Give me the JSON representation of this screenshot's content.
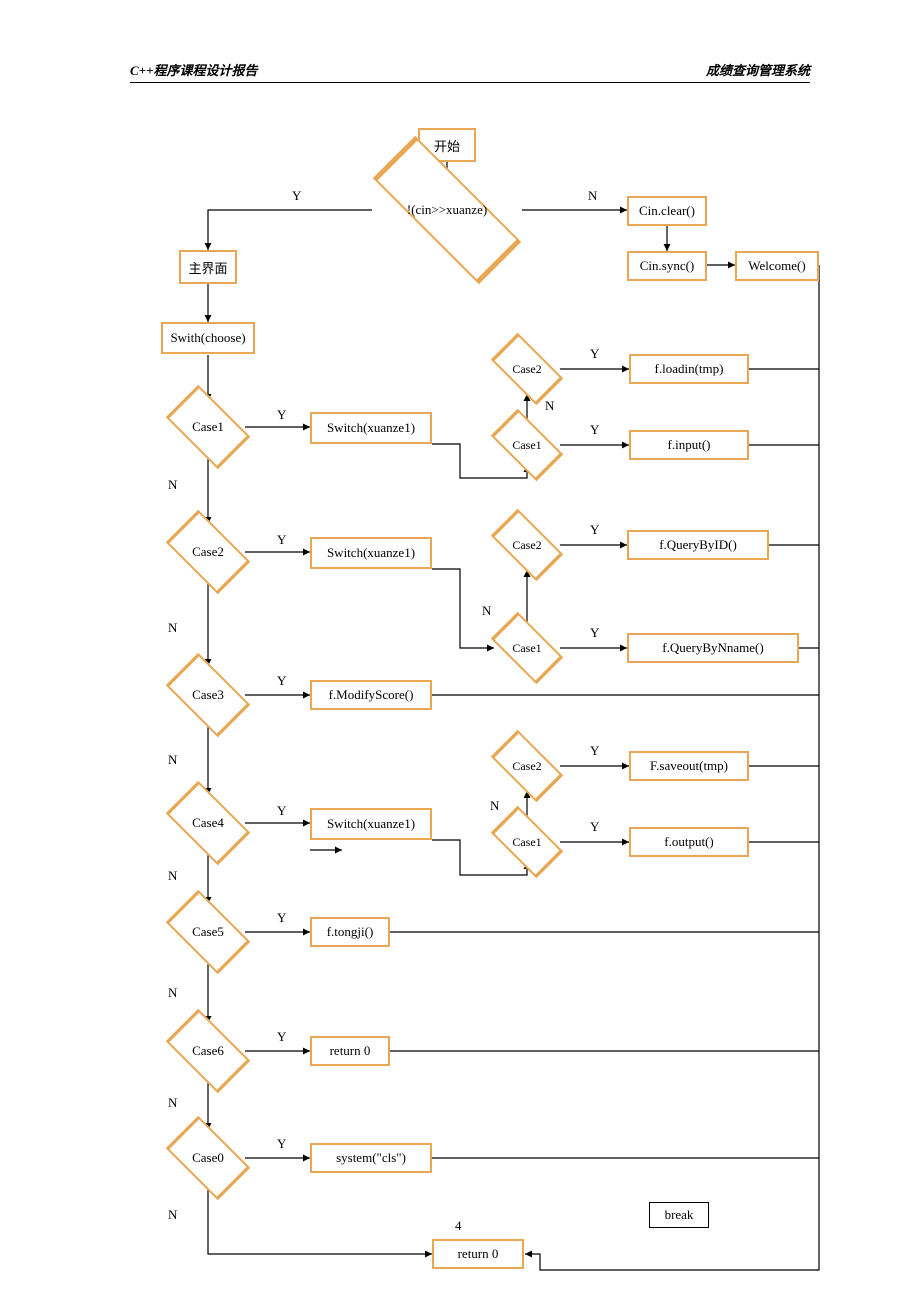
{
  "header": {
    "left": "C++程序课程设计报告",
    "right": "成绩查询管理系统"
  },
  "start": "开始",
  "cin": "!(cin>>xuanze)",
  "cinClear": "Cin.clear()",
  "cinSync": "Cin.sync()",
  "welcome": "Welcome()",
  "main": "主界面",
  "switchChoose": "Swith(choose)",
  "switchX1": "Switch(xuanze1)",
  "switchX2": "Switch(xuanze1)",
  "switchX3": "Switch(xuanze1)",
  "c1": "Case1",
  "c2": "Case2",
  "c3": "Case3",
  "c4": "Case4",
  "c5": "Case5",
  "c6": "Case6",
  "c0": "Case0",
  "sc1": "Case1",
  "sc2": "Case2",
  "scA": "Case1",
  "scB": "Case2",
  "scC": "Case1",
  "scD": "Case2",
  "floadin": "f.loadin(tmp)",
  "finput": "f.input()",
  "qById": "f.QueryByID()",
  "qByName": "f.QueryByNname()",
  "modify": "f.ModifyScore()",
  "saveout": "F.saveout(tmp)",
  "foutput": "f.output()",
  "tongji": "f.tongji()",
  "ret0": "return 0",
  "sysCls": "system(\"cls\")",
  "retEnd": "return 0",
  "break": "break",
  "Y": "Y",
  "N": "N",
  "pageNum": "4"
}
